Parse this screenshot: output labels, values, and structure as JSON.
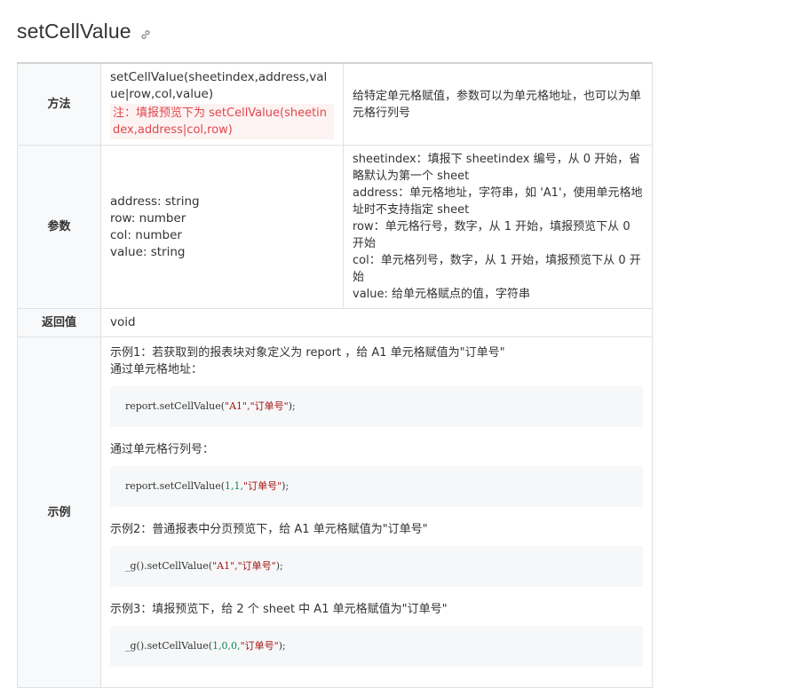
{
  "title": "setCellValue",
  "rows": {
    "method": {
      "header": "方法",
      "signature": "setCellValue(sheetindex,address,value|row,col,value)",
      "note": "注：填报预览下为 setCellValue(sheetindex,address|col,row)",
      "description": "给特定单元格赋值，参数可以为单元格地址，也可以为单元格行列号"
    },
    "params": {
      "header": "参数",
      "list": [
        "address: string",
        "row: number",
        "col: number",
        "value: string"
      ],
      "descriptions": [
        "sheetindex：填报下 sheetindex 编号，从 0 开始，省略默认为第一个 sheet",
        "address：单元格地址，字符串，如 'A1'，使用单元格地址时不支持指定 sheet",
        "row：单元格行号，数字，从 1 开始，填报预览下从 0 开始",
        "col：单元格列号，数字，从 1 开始，填报预览下从 0 开始",
        "value: 给单元格赋点的值，字符串"
      ]
    },
    "returns": {
      "header": "返回值",
      "value": "void"
    },
    "examples": {
      "header": "示例",
      "ex1_title": "示例1：若获取到的报表块对象定义为 report ，给 A1 单元格赋值为\"订单号\"",
      "ex1_sub1": "通过单元格地址：",
      "code1": {
        "prefix": "report.setCellValue(",
        "args": "\"A1\",\"订单号\"",
        "suffix": ");"
      },
      "ex1_sub2": "通过单元格行列号：",
      "code2": {
        "prefix": "report.setCellValue(",
        "nums": "1,1,",
        "str": "\"订单号\"",
        "suffix": ");"
      },
      "ex2_title": "示例2：普通报表中分页预览下，给 A1 单元格赋值为\"订单号\"",
      "code3": {
        "prefix": "_g().setCellValue(",
        "args": "\"A1\",\"订单号\"",
        "suffix": ");"
      },
      "ex3_title": "示例3：填报预览下，给 2 个 sheet 中 A1 单元格赋值为\"订单号\"",
      "code4": {
        "prefix": "_g().setCellValue(",
        "nums": "1,0,0,",
        "str": "\"订单号\"",
        "suffix": ");"
      }
    }
  },
  "icons": {
    "title_link": "link-icon"
  }
}
